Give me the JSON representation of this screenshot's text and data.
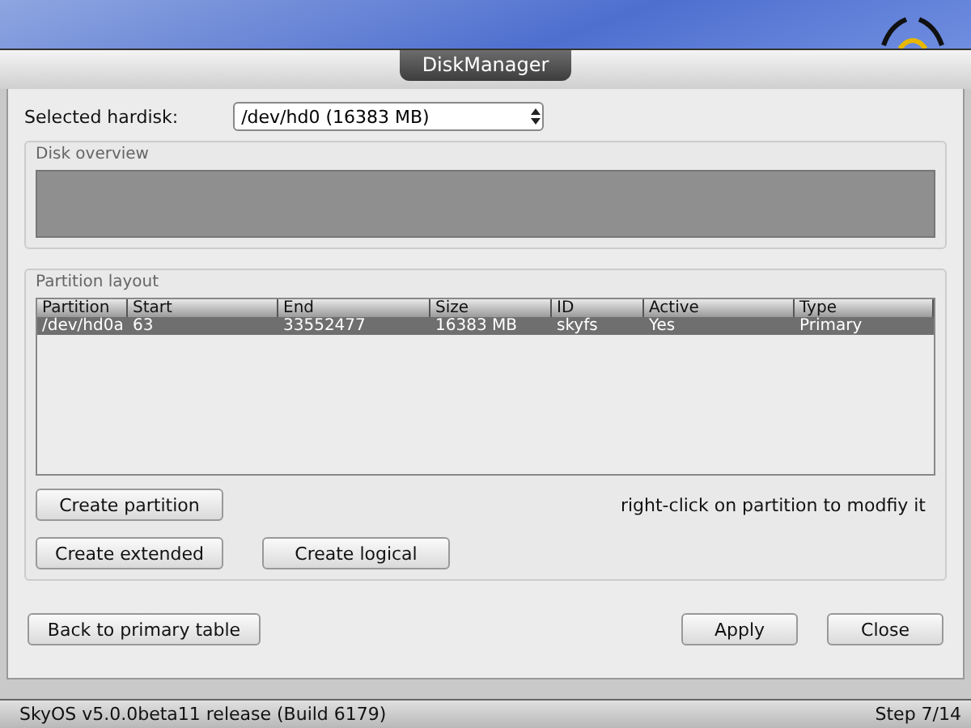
{
  "window": {
    "title": "DiskManager"
  },
  "hardisk": {
    "label": "Selected hardisk:",
    "value": "/dev/hd0 (16383 MB)"
  },
  "disk_overview": {
    "title": "Disk overview"
  },
  "partition_layout": {
    "title": "Partition layout",
    "columns": [
      "Partition",
      "Start",
      "End",
      "Size",
      "ID",
      "Active",
      "Type"
    ],
    "rows": [
      {
        "cells": [
          "/dev/hd0a",
          "63",
          "33552477",
          "16383 MB",
          "skyfs",
          "Yes",
          "Primary"
        ],
        "selected": true
      }
    ],
    "buttons": [
      "Create partition",
      "Create extended",
      "Create logical"
    ],
    "hint": "right-click on partition to modfiy it"
  },
  "footer_buttons": [
    "Back to primary table",
    "Apply",
    "Close"
  ],
  "status_bar": {
    "left": "SkyOS v5.0.0beta11 release (Build 6179)",
    "right": "Step 7/14"
  }
}
